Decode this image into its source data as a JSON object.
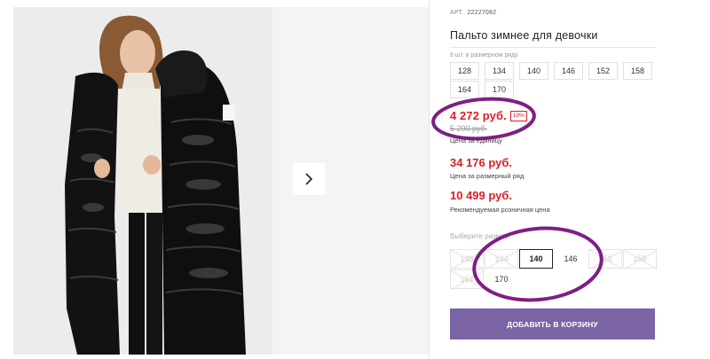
{
  "product": {
    "sku_label": "АРТ.",
    "sku_value": "22227082",
    "title": "Пальто зимнее для девочки",
    "run_note": "8 шт. в размерном ряду"
  },
  "run_sizes": [
    "128",
    "134",
    "140",
    "146",
    "152",
    "158",
    "164",
    "170"
  ],
  "prices": {
    "main": "4 272 руб.",
    "badge": "19%",
    "old": "5 290 руб.",
    "unit_label": "Цена за единицу",
    "run_price": "34 176 руб.",
    "run_label": "Цена за размерный ряд",
    "rrp": "10 499 руб.",
    "rrp_label": "Рекомендуемая розничная цена"
  },
  "choose": {
    "label": "Выберите размер:",
    "options": [
      {
        "value": "128",
        "state": "disabled"
      },
      {
        "value": "134",
        "state": "disabled"
      },
      {
        "value": "140",
        "state": "selected"
      },
      {
        "value": "146",
        "state": "available"
      },
      {
        "value": "152",
        "state": "disabled"
      },
      {
        "value": "158",
        "state": "disabled"
      },
      {
        "value": "164",
        "state": "disabled"
      },
      {
        "value": "170",
        "state": "available"
      }
    ]
  },
  "cart": {
    "label": "ДОБАВИТЬ В КОРЗИНУ"
  },
  "gallery": {
    "next_icon": "chevron-right-icon"
  },
  "colors": {
    "accent": "#7a64a6",
    "price": "#d91f27",
    "annotation": "#7d1f86"
  }
}
